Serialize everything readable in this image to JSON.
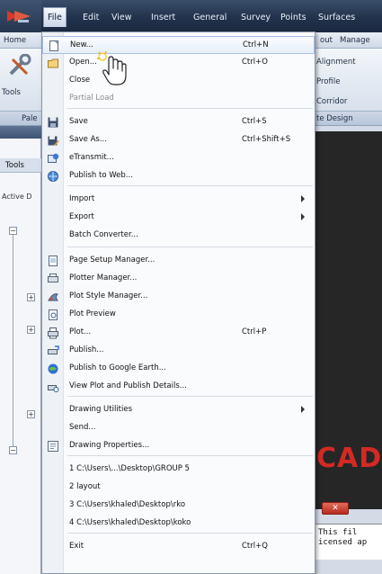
{
  "menubar": {
    "titles": [
      "File",
      "Edit",
      "View",
      "Insert",
      "General",
      "Survey",
      "Points",
      "Surfaces"
    ]
  },
  "ribbon": {
    "tabs": [
      "Home",
      "out",
      "Manage"
    ],
    "panel": {
      "left_label": "Tools",
      "alignment": "Alignment",
      "profile": "Profile",
      "corridor": "Corridor",
      "site_design": "te Design"
    },
    "footer": {
      "left": "Pale"
    }
  },
  "left_palette": {
    "tools_label": "Tools",
    "active_label": "Active D"
  },
  "drawing": {
    "logo_text": "CAD",
    "close_label": "✕",
    "console_lines": [
      "This fil",
      "icensed ap"
    ]
  },
  "file_menu": {
    "items": [
      {
        "label": "New...",
        "shortcut": "Ctrl+N",
        "icon": "new-icon"
      },
      {
        "label": "Open...",
        "shortcut": "Ctrl+O",
        "icon": "open-icon"
      },
      {
        "label": "Close",
        "shortcut": "",
        "icon": ""
      },
      {
        "label": "Partial Load",
        "shortcut": "",
        "icon": "",
        "disabled": true
      },
      {
        "label": "Save",
        "shortcut": "Ctrl+S",
        "icon": "save-icon"
      },
      {
        "label": "Save As...",
        "shortcut": "Ctrl+Shift+S",
        "icon": "save-as-icon"
      },
      {
        "label": "eTransmit...",
        "shortcut": "",
        "icon": "etransmit-icon"
      },
      {
        "label": "Publish to Web...",
        "shortcut": "",
        "icon": "publish-web-icon"
      },
      {
        "label": "Import",
        "shortcut": "",
        "icon": "",
        "submenu": true
      },
      {
        "label": "Export",
        "shortcut": "",
        "icon": "",
        "submenu": true
      },
      {
        "label": "Batch Converter...",
        "shortcut": "",
        "icon": ""
      },
      {
        "label": "Page Setup Manager...",
        "shortcut": "",
        "icon": "page-setup-icon"
      },
      {
        "label": "Plotter Manager...",
        "shortcut": "",
        "icon": "plotter-icon"
      },
      {
        "label": "Plot Style Manager...",
        "shortcut": "",
        "icon": "plot-style-icon"
      },
      {
        "label": "Plot Preview",
        "shortcut": "",
        "icon": "plot-preview-icon"
      },
      {
        "label": "Plot...",
        "shortcut": "Ctrl+P",
        "icon": "plot-icon"
      },
      {
        "label": "Publish...",
        "shortcut": "",
        "icon": "publish-icon"
      },
      {
        "label": "Publish to Google Earth...",
        "shortcut": "",
        "icon": "google-earth-icon"
      },
      {
        "label": "View Plot and Publish Details...",
        "shortcut": "",
        "icon": "plot-details-icon"
      },
      {
        "label": "Drawing Utilities",
        "shortcut": "",
        "icon": "",
        "submenu": true
      },
      {
        "label": "Send...",
        "shortcut": "",
        "icon": ""
      },
      {
        "label": "Drawing Properties...",
        "shortcut": "",
        "icon": "properties-icon"
      },
      {
        "label": "1 C:\\Users\\...\\Desktop\\GROUP 5",
        "shortcut": "",
        "icon": ""
      },
      {
        "label": "2 layout",
        "shortcut": "",
        "icon": ""
      },
      {
        "label": "3 C:\\Users\\khaled\\Desktop\\rko",
        "shortcut": "",
        "icon": ""
      },
      {
        "label": "4 C:\\Users\\khaled\\Desktop\\koko",
        "shortcut": "",
        "icon": ""
      },
      {
        "label": "Exit",
        "shortcut": "Ctrl+Q",
        "icon": ""
      }
    ]
  },
  "colors": {
    "menubar": "#22324c",
    "highlight_border": "#a7c0e3",
    "cad_red": "#d32a23"
  }
}
